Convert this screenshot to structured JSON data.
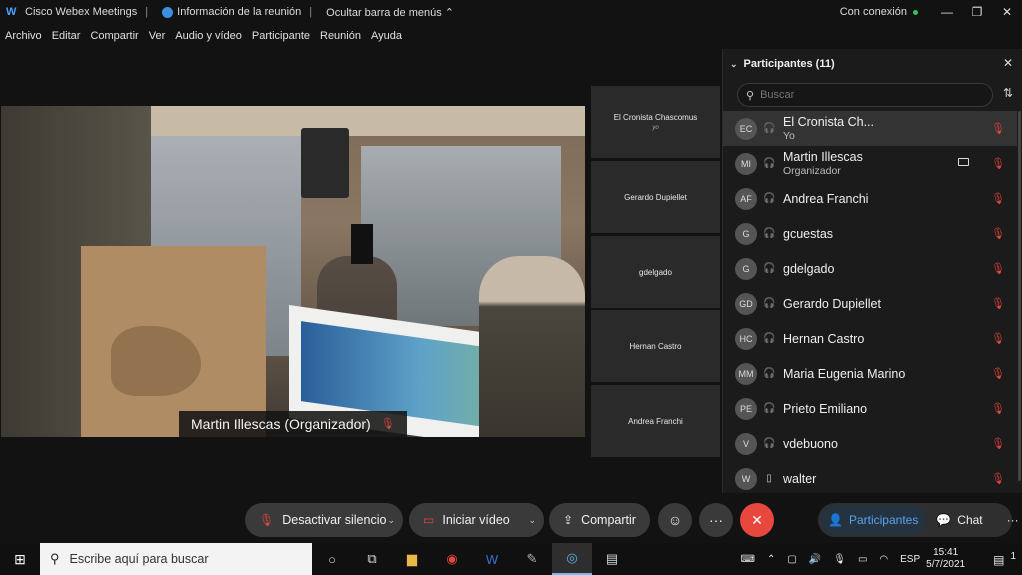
{
  "titlebar": {
    "app_name": "Cisco Webex Meetings",
    "meeting_info": "Información de la reunión",
    "hide_menu": "Ocultar barra de menús",
    "connection": "Con conexión"
  },
  "menu": [
    "Archivo",
    "Editar",
    "Compartir",
    "Ver",
    "Audio y vídeo",
    "Participante",
    "Reunión",
    "Ayuda"
  ],
  "main_video": {
    "speaker_label": "Martin Illescas (Organizador)"
  },
  "thumbnails": [
    {
      "name": "El Cronista Chascomus",
      "sub": "yo"
    },
    {
      "name": "Gerardo Dupiellet",
      "sub": ""
    },
    {
      "name": "gdelgado",
      "sub": ""
    },
    {
      "name": "Hernan Castro",
      "sub": ""
    },
    {
      "name": "Andrea Franchi",
      "sub": ""
    }
  ],
  "participants_panel": {
    "title": "Participantes (11)",
    "search_placeholder": "Buscar",
    "participants": [
      {
        "initials": "EC",
        "name": "El Cronista Ch...",
        "role": "Yo",
        "device": "headset"
      },
      {
        "initials": "MI",
        "name": "Martin Illescas",
        "role": "Organizador",
        "device": "headset"
      },
      {
        "initials": "AF",
        "name": "Andrea Franchi",
        "role": "",
        "device": "headset"
      },
      {
        "initials": "G",
        "name": "gcuestas",
        "role": "",
        "device": "headset"
      },
      {
        "initials": "G",
        "name": "gdelgado",
        "role": "",
        "device": "headset"
      },
      {
        "initials": "GD",
        "name": "Gerardo Dupiellet",
        "role": "",
        "device": "headset"
      },
      {
        "initials": "HC",
        "name": "Hernan Castro",
        "role": "",
        "device": "headset"
      },
      {
        "initials": "MM",
        "name": "Maria Eugenia Marino",
        "role": "",
        "device": "headset"
      },
      {
        "initials": "PE",
        "name": "Prieto Emiliano",
        "role": "",
        "device": "headset"
      },
      {
        "initials": "V",
        "name": "vdebuono",
        "role": "",
        "device": "headset"
      },
      {
        "initials": "W",
        "name": "walter",
        "role": "",
        "device": "phone"
      }
    ]
  },
  "controls": {
    "unmute": "Desactivar silencio",
    "start_video": "Iniciar vídeo",
    "share": "Compartir",
    "participants_tab": "Participantes",
    "chat_tab": "Chat"
  },
  "taskbar": {
    "search_placeholder": "Escribe aquí para buscar",
    "language": "ESP",
    "time": "15:41",
    "date": "5/7/2021",
    "notification_count": "1"
  },
  "colors": {
    "muted_red": "#e0453e",
    "end_call": "#e8473e",
    "accent_blue": "#56a4f0",
    "online_green": "#36c05a"
  }
}
